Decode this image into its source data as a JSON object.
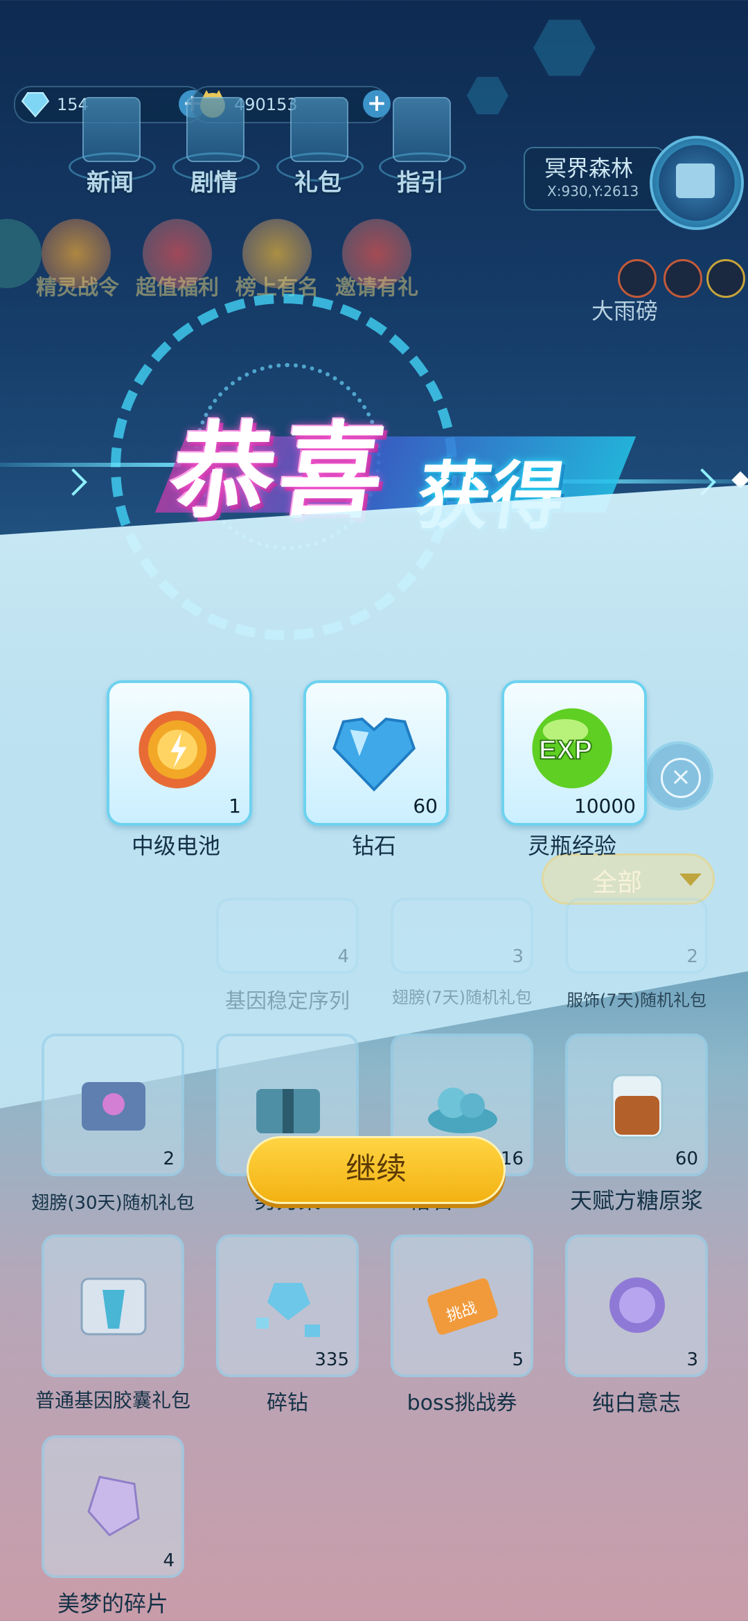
{
  "hud": {
    "diamonds": "154",
    "gold": "490153",
    "top_buttons": [
      "新闻",
      "剧情",
      "礼包",
      "指引"
    ],
    "location_name": "冥界森林",
    "location_coord": "X:930,Y:2613",
    "activity_labels": [
      "精灵战令",
      "超值福利",
      "榜上有名",
      "邀请有礼"
    ],
    "weather": "大雨磅"
  },
  "popup": {
    "title_main": "恭喜",
    "title_sub": "获得",
    "rewards": [
      {
        "name": "中级电池",
        "count": "1",
        "icon": "battery-icon"
      },
      {
        "name": "钻石",
        "count": "60",
        "icon": "diamond-icon"
      },
      {
        "name": "灵瓶经验",
        "count": "10000",
        "icon": "exp-icon"
      }
    ],
    "exp_label": "EXP",
    "continue_label": "继续"
  },
  "bag": {
    "filter_label": "全部",
    "items": [
      {
        "name": "基因稳定序列",
        "count": "4"
      },
      {
        "name": "翅膀(7天)随机礼包",
        "count": "3"
      },
      {
        "name": "服饰(7天)随机礼包",
        "count": "2"
      },
      {
        "name": "翅膀(30天)随机礼包",
        "count": "2"
      },
      {
        "name": "努力菜",
        "count": ""
      },
      {
        "name": "格石",
        "count": "16"
      },
      {
        "name": "天赋方糖原浆",
        "count": "60"
      },
      {
        "name": "普通基因胶囊礼包",
        "count": ""
      },
      {
        "name": "碎钻",
        "count": "335"
      },
      {
        "name": "boss挑战券",
        "count": "5"
      },
      {
        "name": "纯白意志",
        "count": "3"
      },
      {
        "name": "美梦的碎片",
        "count": "4"
      }
    ],
    "ticket_text": "挑战"
  },
  "colors": {
    "accent": "#6dd2ef",
    "button": "#ffd443",
    "title_glow": "#ff5cd4"
  }
}
